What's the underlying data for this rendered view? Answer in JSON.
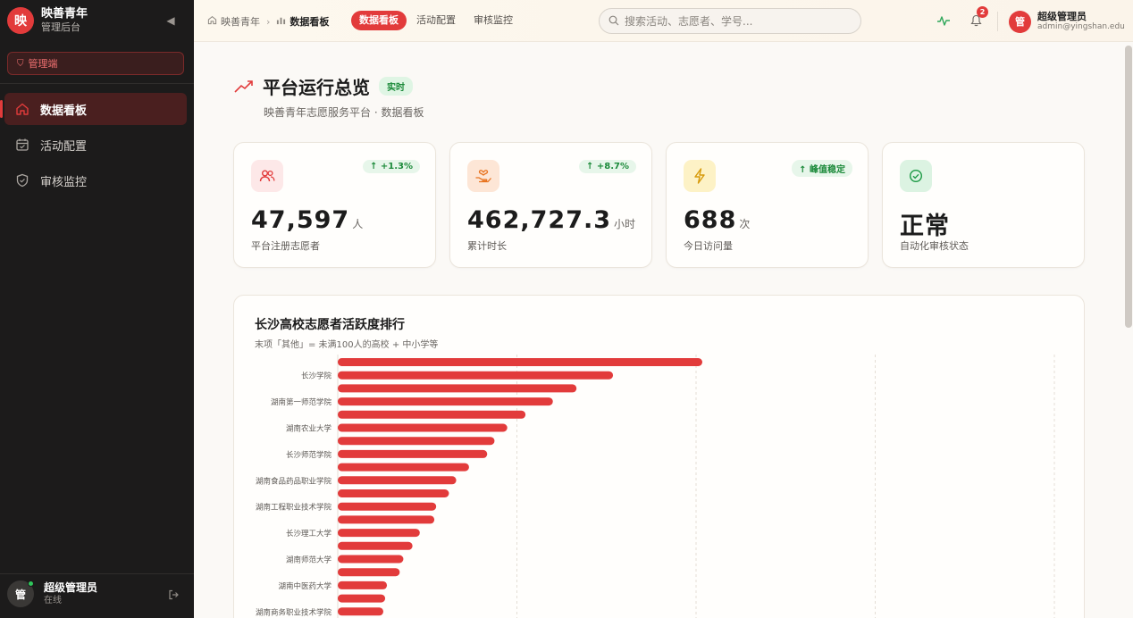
{
  "sidebar": {
    "brand_logo": "映",
    "brand_title": "映善青年",
    "brand_sub": "管理后台",
    "role_badge": "管理端",
    "items": [
      {
        "label": "数据看板",
        "icon": "home-icon",
        "active": true
      },
      {
        "label": "活动配置",
        "icon": "calendar-icon",
        "active": false
      },
      {
        "label": "审核监控",
        "icon": "shield-check-icon",
        "active": false
      }
    ],
    "user": {
      "avatar": "管",
      "name": "超级管理员",
      "status": "在线"
    }
  },
  "topbar": {
    "breadcrumb": [
      "映善青年",
      "数据看板"
    ],
    "tabs": [
      {
        "label": "数据看板",
        "active": true
      },
      {
        "label": "活动配置",
        "active": false
      },
      {
        "label": "审核监控",
        "active": false
      }
    ],
    "search_placeholder": "搜索活动、志愿者、学号...",
    "notification_count": "2",
    "admin": {
      "avatar": "管",
      "name": "超级管理员",
      "email": "admin@yingshan.edu"
    }
  },
  "page": {
    "title": "平台运行总览",
    "tag": "实时",
    "subtitle": "映善青年志愿服务平台 · 数据看板"
  },
  "stats": [
    {
      "value": "47,597",
      "unit": "人",
      "label": "平台注册志愿者",
      "trend": "↑ +1.3%",
      "icon": "users-icon",
      "icon_bg": "#fde8e8",
      "icon_color": "#e23b3b"
    },
    {
      "value": "462,727.3",
      "unit": "小时",
      "label": "累计时长",
      "trend": "↑ +8.7%",
      "icon": "hand-heart-icon",
      "icon_bg": "#fde6d6",
      "icon_color": "#e8731f"
    },
    {
      "value": "688",
      "unit": "次",
      "label": "今日访问量",
      "trend": "↑ 峰值稳定",
      "icon": "lightning-icon",
      "icon_bg": "#fdf2c6",
      "icon_color": "#d79a0a"
    },
    {
      "value": "正常",
      "unit": "",
      "label": "自动化审核状态",
      "trend": "",
      "icon": "check-circle-icon",
      "icon_bg": "#dcf3e2",
      "icon_color": "#1c9a45"
    }
  ],
  "chart_data": {
    "type": "bar",
    "orientation": "horizontal",
    "title": "长沙高校志愿者活跃度排行",
    "subtitle": "末项「其他」= 未满100人的高校 + 中小学等",
    "labeled_categories": [
      "长沙学院",
      "湖南第一师范学院",
      "湖南农业大学",
      "长沙师范学院",
      "湖南食品药品职业学院",
      "湖南工程职业技术学院",
      "长沙理工大学",
      "湖南师范大学",
      "湖南中医药大学",
      "湖南商务职业技术学院"
    ],
    "label_every_other_starting_index": 1,
    "values": [
      100,
      75.5,
      65.5,
      59,
      51.5,
      46.5,
      43,
      41,
      36,
      32.5,
      30.5,
      27,
      26.5,
      22.5,
      20.5,
      18,
      17,
      13.5,
      13,
      12.5
    ],
    "value_scale": "relative to top bar = 100",
    "grid": "vertical dashed",
    "bar_color": "#e23b3b"
  }
}
